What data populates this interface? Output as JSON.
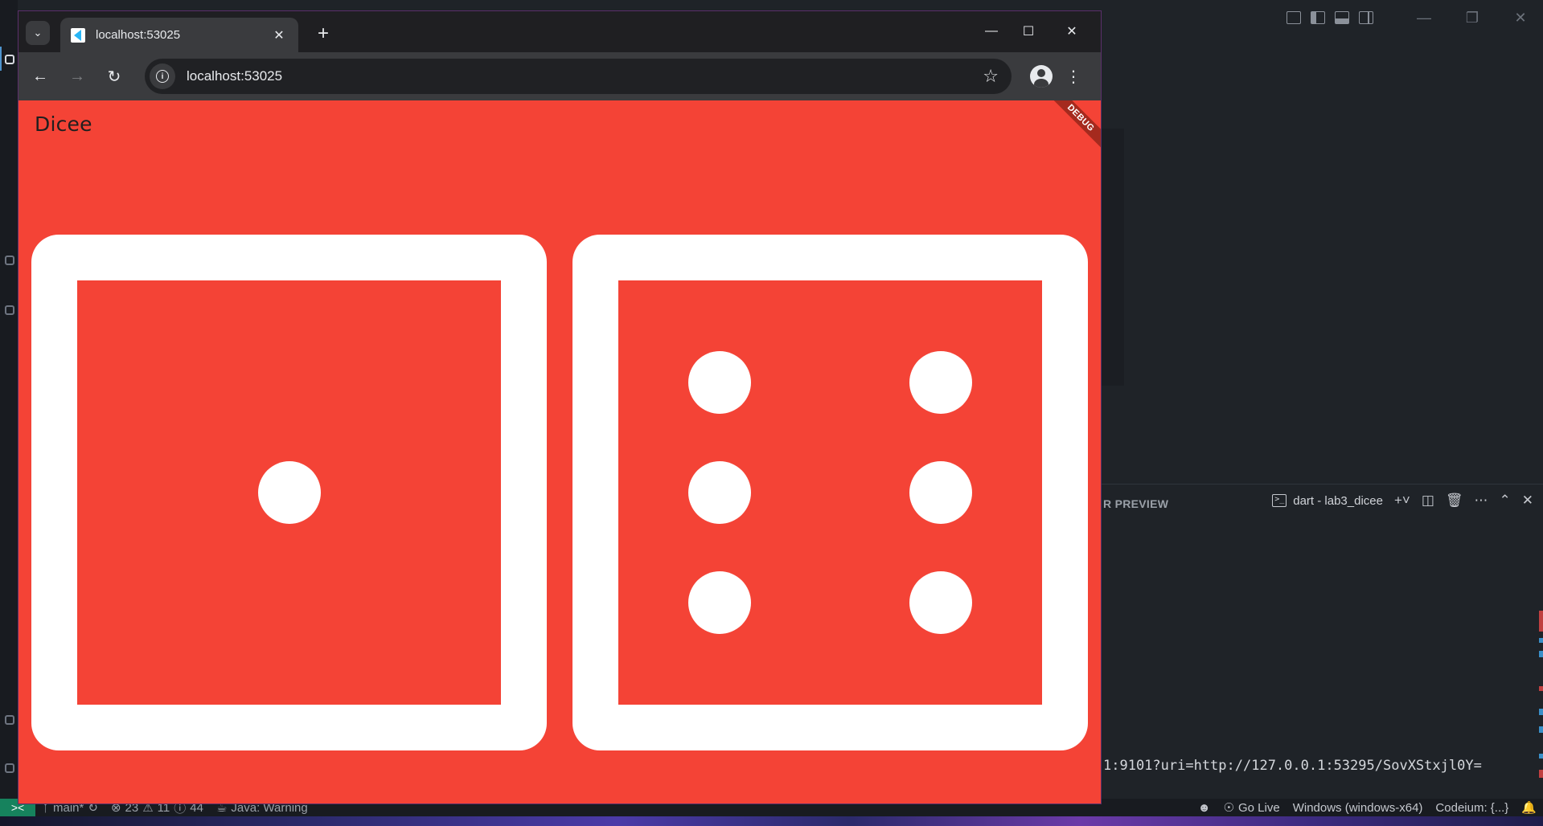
{
  "browser": {
    "tab_title": "localhost:53025",
    "url": "localhost:53025",
    "icons": {
      "tab_search": "chevron-down-icon",
      "tab_close": "close-icon",
      "new_tab": "plus-icon",
      "back": "arrow-left-icon",
      "forward": "arrow-right-icon",
      "reload": "reload-icon",
      "site_info": "info-icon",
      "bookmark": "star-icon",
      "profile": "profile-icon",
      "menu": "kebab-menu-icon"
    }
  },
  "app": {
    "title": "Dicee",
    "debug_banner": "DEBUG",
    "background_color": "#f44336",
    "dice": [
      {
        "value": 1
      },
      {
        "value": 6
      }
    ]
  },
  "vscode": {
    "panel_tab": "R PREVIEW",
    "terminal_name": "dart - lab3_dicee",
    "terminal_line": "1:9101?uri=http://127.0.0.1:53295/SovXStxjl0Y=",
    "status_bar": {
      "branch": "main*",
      "errors": "23",
      "warnings": "11",
      "infos": "44",
      "java": "Java: Warning",
      "go_live": "Go Live",
      "platform": "Windows (windows-x64)",
      "codeium": "Codeium: {...}"
    }
  }
}
